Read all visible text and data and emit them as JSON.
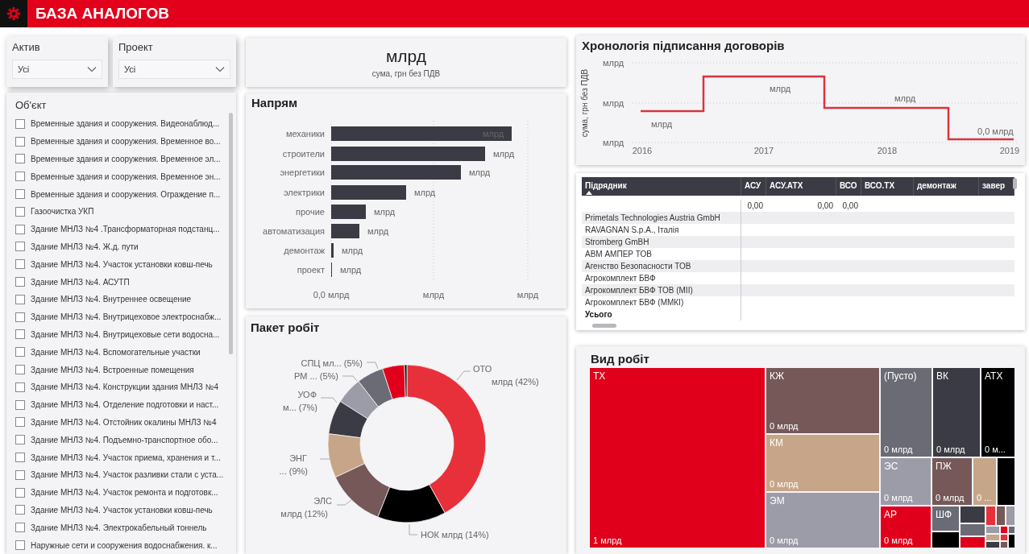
{
  "header": {
    "title": "БАЗА АНАЛОГОВ"
  },
  "slicers": [
    {
      "label": "Актив",
      "value": "Усі"
    },
    {
      "label": "Проект",
      "value": "Усі"
    }
  ],
  "object_list": {
    "title": "Об'єкт",
    "items": [
      {
        "label": "Временные здания и сооружения. Видеонаблюд...",
        "checked": false
      },
      {
        "label": "Временные здания и сооружения. Временное во...",
        "checked": false
      },
      {
        "label": "Временные здания и сооружения. Временное эл...",
        "checked": false
      },
      {
        "label": "Временные здания и сооружения. Временное эн...",
        "checked": false
      },
      {
        "label": "Временные здания и сооружения. Ограждение п...",
        "checked": false
      },
      {
        "label": "Газоочистка УКП",
        "checked": false
      },
      {
        "label": "Здание МНЛЗ №4 .Трансформаторная подстанц...",
        "checked": false
      },
      {
        "label": "Здание МНЛЗ №4. Ж.д. пути",
        "checked": false
      },
      {
        "label": "Здание МНЛЗ №4. Участок установки ковш-печь",
        "checked": false
      },
      {
        "label": "Здание МНЛЗ №4. АСУТП",
        "checked": false
      },
      {
        "label": "Здание МНЛЗ №4. Внутреннее освещение",
        "checked": false
      },
      {
        "label": "Здание МНЛЗ №4. Внутрицеховое электроснабж...",
        "checked": false
      },
      {
        "label": "Здание МНЛЗ №4. Внутрицеховые сети водосна...",
        "checked": false
      },
      {
        "label": "Здание МНЛЗ №4. Вспомогательные участки",
        "checked": false
      },
      {
        "label": "Здание МНЛЗ №4. Встроенные помещения",
        "checked": false
      },
      {
        "label": "Здание МНЛЗ №4. Конструкции здания МНЛЗ №4",
        "checked": false
      },
      {
        "label": "Здание МНЛЗ №4. Отделение подготовки и наст...",
        "checked": false
      },
      {
        "label": "Здание МНЛЗ №4. Отстойник окалины МНЛЗ №4",
        "checked": false
      },
      {
        "label": "Здание МНЛЗ №4. Подъемно-транспортное обо...",
        "checked": false
      },
      {
        "label": "Здание МНЛЗ №4. Участок приема, хранения и т...",
        "checked": false
      },
      {
        "label": "Здание МНЛЗ №4. Участок разливки стали с уста...",
        "checked": false
      },
      {
        "label": "Здание МНЛЗ №4. Участок ремонта и подготовк...",
        "checked": false
      },
      {
        "label": "Здание МНЛЗ №4. Участок установки ковш-печь",
        "checked": false
      },
      {
        "label": "Здание МНЛЗ №4. Электрокабельный тоннель",
        "checked": false
      },
      {
        "label": "Наружные сети и сооружения водоснабжения. к...",
        "checked": false
      }
    ]
  },
  "kpi": {
    "value": "млрд",
    "caption": "сума, грн без ПДВ"
  },
  "direction_chart": {
    "title": "Напрям",
    "bars": [
      {
        "label": "механики",
        "value_label": "млрд"
      },
      {
        "label": "строители",
        "value_label": "млрд"
      },
      {
        "label": "энергетики",
        "value_label": "млрд"
      },
      {
        "label": "электрики",
        "value_label": "млрд"
      },
      {
        "label": "прочие",
        "value_label": "млрд"
      },
      {
        "label": "автоматизация",
        "value_label": "млрд"
      },
      {
        "label": "демонтаж",
        "value_label": "млрд"
      },
      {
        "label": "проект",
        "value_label": "млрд"
      }
    ],
    "axis_labels": [
      "0,0 млрд",
      "млрд",
      "млрд"
    ]
  },
  "work_package_chart": {
    "title": "Пакет робіт",
    "slices": [
      {
        "label": "СПЦ",
        "detail": "мл... (5%)",
        "color": "#6b6b75"
      },
      {
        "label": "РМ",
        "detail": "... (5%)",
        "color": "#9c9ba8"
      },
      {
        "label": "УОФ",
        "detail": "м... (7%)",
        "color": "#3b3b45"
      },
      {
        "label": "ЭНГ",
        "detail": "... (9%)",
        "color": "#c6a588"
      },
      {
        "label": "ЭЛС",
        "detail": "млрд (12%)",
        "color": "#765858"
      },
      {
        "label": "НОК",
        "detail": "млрд (14%)",
        "color": "#000000"
      },
      {
        "label": "ОТО",
        "detail": "млрд (42%)",
        "color": "#e8303a"
      },
      {
        "color": "#e0001b"
      },
      {
        "color": "#111111"
      }
    ]
  },
  "timeline": {
    "title": "Хронологія підписання договорів",
    "y_axis_title": "сума, грн без ПДВ",
    "y_tick_labels": [
      "млрд",
      "млрд",
      "млрд"
    ],
    "x_tick_labels": [
      "2016",
      "2017",
      "2018",
      "2019"
    ],
    "data_labels": [
      "млрд",
      "млрд",
      "млрд",
      "0,0 млрд"
    ]
  },
  "table": {
    "columns": [
      {
        "label": "Підрядник",
        "sorted": true
      },
      {
        "label": "АСУ",
        "sorted": false
      },
      {
        "label": "АСУ.АТХ",
        "sorted": false
      },
      {
        "label": "ВСО",
        "sorted": false
      },
      {
        "label": "ВСО.ТХ",
        "sorted": false
      },
      {
        "label": "демонтаж",
        "sorted": false
      },
      {
        "label": "завер",
        "sorted": false
      }
    ],
    "rows": [
      {
        "kind": "row",
        "cells": [
          "0,00",
          "0,00",
          "0,00"
        ]
      },
      {
        "kind": "row",
        "contractor": "Primetals Technologies Austria GmbH"
      },
      {
        "kind": "row",
        "contractor": "RAVAGNAN S.p.A., Італія"
      },
      {
        "kind": "row",
        "contractor": "Stromberg GmBH"
      },
      {
        "kind": "row",
        "contractor": "АВМ АМПЕР ТОВ"
      },
      {
        "kind": "row",
        "contractor": "Агенство Безопасности ТОВ"
      },
      {
        "kind": "row",
        "contractor": "Агрокомплект БВФ"
      },
      {
        "kind": "row",
        "contractor": "Агрокомплект БВФ ТОВ (МІІ)"
      },
      {
        "kind": "row",
        "contractor": "Агрокомплект БВФ (ММКІ)"
      },
      {
        "kind": "total",
        "contractor": "Усього"
      }
    ]
  },
  "treemap": {
    "title": "Вид робіт",
    "tiles": [
      {
        "label": "ТХ",
        "amount": "1 млрд",
        "color": "#e0001b"
      },
      {
        "label": "КЖ",
        "amount": "0 млрд",
        "color": "#765858"
      },
      {
        "label": "КМ",
        "amount": "0 млрд",
        "color": "#c6a588"
      },
      {
        "label": "ЭМ",
        "amount": "0 млрд",
        "color": "#9c9ba8"
      },
      {
        "label": "(Пусто)",
        "amount": "0 млрд",
        "color": "#6b6b75"
      },
      {
        "label": "ВК",
        "amount": "0 млрд",
        "color": "#3b3b45"
      },
      {
        "label": "АТХ",
        "amount": "0 м...",
        "color": "#000000"
      },
      {
        "label": "ЭС",
        "amount": "0 млрд",
        "color": "#9c9ba8"
      },
      {
        "label": "ПЖ",
        "amount": "0 млрд",
        "color": "#765858"
      },
      {
        "amount": "0 ...",
        "color": "#c6a588"
      },
      {
        "color": "#000000"
      },
      {
        "label": "АР",
        "amount": "0 млрд",
        "color": "#e0001b"
      },
      {
        "label": "ШФ",
        "color": "#6b6b75"
      },
      {
        "color": "#000000"
      },
      {
        "color": "#3b3b45"
      },
      {
        "color": "#6b6b75"
      },
      {
        "color": "#e0001b"
      },
      {
        "color": "#e8303a"
      },
      {
        "color": "#765858"
      },
      {
        "color": "#9c9ba8"
      },
      {
        "color": "#9c9ba8"
      },
      {
        "color": "#e0001b"
      },
      {
        "color": "#6b6b75"
      },
      {
        "color": "#c6a588"
      },
      {
        "color": "#3b3b45"
      },
      {
        "color": "#e8303a"
      },
      {
        "color": "#000000"
      },
      {
        "color": "#765858"
      }
    ]
  }
}
